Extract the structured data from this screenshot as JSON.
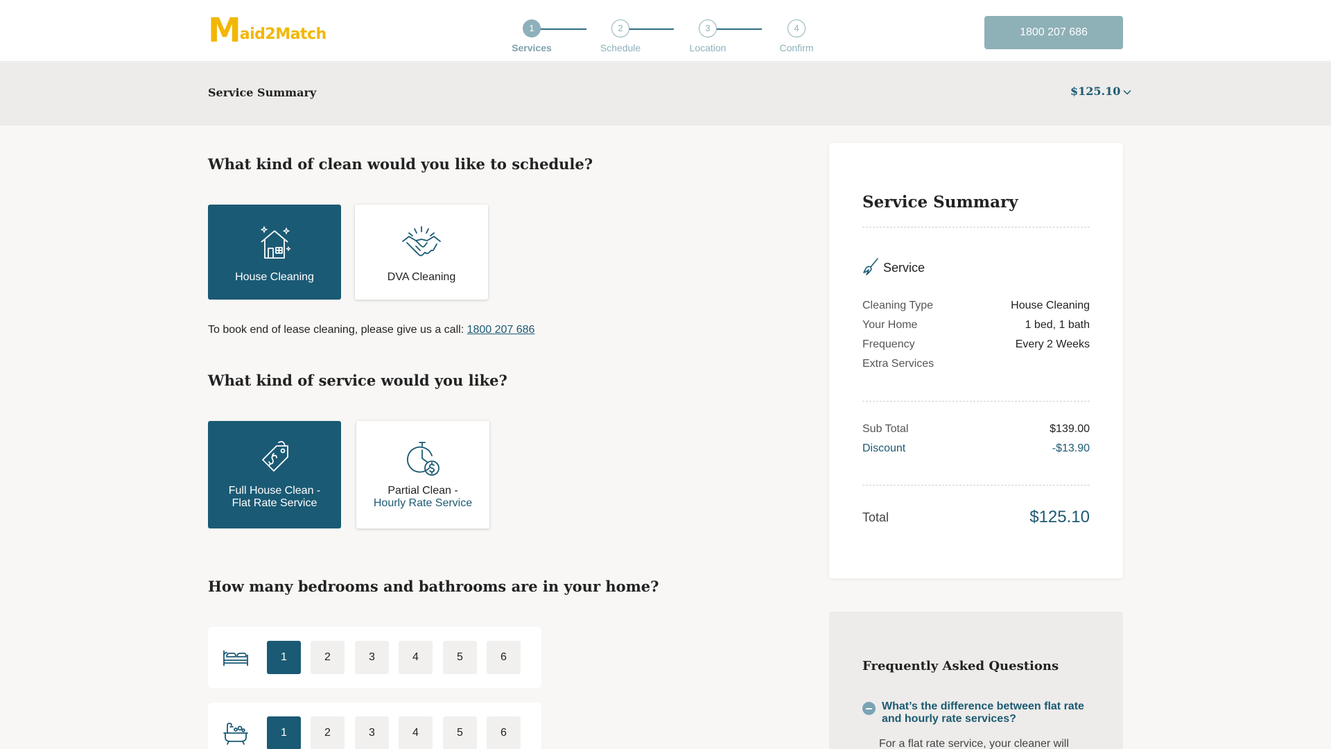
{
  "brand": {
    "logo_big": "M",
    "logo_rest": "aid2Match",
    "color": "#f2b705"
  },
  "stepper": [
    {
      "num": "1",
      "label": "Services",
      "active": true
    },
    {
      "num": "2",
      "label": "Schedule",
      "active": false
    },
    {
      "num": "3",
      "label": "Location",
      "active": false
    },
    {
      "num": "4",
      "label": "Confirm",
      "active": false
    }
  ],
  "header": {
    "phone": "1800 207 686"
  },
  "summary_bar": {
    "title": "Service Summary",
    "price": "$125.10"
  },
  "clean_section": {
    "heading": "What kind of clean would you like to schedule?",
    "options": [
      {
        "label": "House Cleaning",
        "icon": "house-sparkle-icon",
        "selected": true
      },
      {
        "label": "DVA Cleaning",
        "icon": "handshake-icon",
        "selected": false
      }
    ],
    "lease_note": "To book end of lease cleaning, please give us a call: ",
    "lease_phone": "1800 207 686"
  },
  "service_section": {
    "heading": "What kind of service would you like?",
    "options": [
      {
        "line1": "Full House Clean -",
        "line2": "Flat Rate Service",
        "icon": "price-tag-icon",
        "selected": true
      },
      {
        "line1": "Partial Clean -",
        "line2": "Hourly Rate Service",
        "icon": "stopwatch-dollar-icon",
        "selected": false
      }
    ]
  },
  "rooms_section": {
    "heading": "How many bedrooms and bathrooms are in your home?",
    "bedrooms": {
      "icon": "bed-icon",
      "options": [
        "1",
        "2",
        "3",
        "4",
        "5",
        "6"
      ],
      "selected": "1"
    },
    "bathrooms": {
      "icon": "bathtub-icon",
      "options": [
        "1",
        "2",
        "3",
        "4",
        "5",
        "6"
      ],
      "selected": "1"
    }
  },
  "summary_card": {
    "title": "Service Summary",
    "service_label": "Service",
    "rows": [
      {
        "k": "Cleaning Type",
        "v": "House Cleaning"
      },
      {
        "k": "Your Home",
        "v": "1 bed, 1 bath"
      },
      {
        "k": "Frequency",
        "v": "Every 2 Weeks"
      },
      {
        "k": "Extra Services",
        "v": ""
      }
    ],
    "subtotal_label": "Sub Total",
    "subtotal": "$139.00",
    "discount_label": "Discount",
    "discount": "-$13.90",
    "total_label": "Total",
    "total": "$125.10"
  },
  "faq": {
    "title": "Frequently Asked Questions",
    "question": "What’s the difference between flat rate and hourly rate services?",
    "answer": "For a flat rate service, your cleaner will"
  },
  "colors": {
    "primary": "#1b5a74",
    "accent": "#8eb0b7",
    "brand": "#f2b705"
  }
}
